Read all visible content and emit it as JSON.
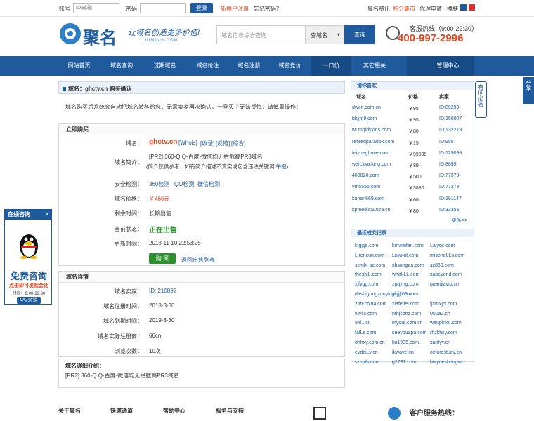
{
  "topbar": {
    "account_label": "账号",
    "account_placeholder": "ID/邮箱",
    "password_label": "密码",
    "login": "登录",
    "register": "新用户注册",
    "forgot": "忘记密码？",
    "news": "聚名资讯",
    "points": "积分集市",
    "agent": "代理申请",
    "skin": "换肤"
  },
  "header": {
    "logo": "聚名",
    "slogan": "让域名创造更多价值!",
    "slogan_sub": "JUMING.COM",
    "search_placeholder": "域名信息综合查询",
    "search_select": "查域名",
    "search_button": "查询",
    "phone_label": "客服热线（9:00-22:30）",
    "phone": "400-997-2996"
  },
  "nav": [
    "网站首页",
    "域名查询",
    "过期域名",
    "域名抢注",
    "域名注册",
    "域名竞价",
    "一口价",
    "其它相关",
    "管理中心"
  ],
  "crumb": "域名：ghctv.cn 购买确认",
  "note": "域名购买后系统会自动把域名转移给您，无需卖家再次确认，一旦买了无法反悔，请慎重操作！",
  "buy": {
    "title": "立即购买",
    "domain_label": "域名：",
    "domain": "ghctv.cn",
    "whois": "[Whois]",
    "indexed": "[收录]",
    "backlinks": "[反链]",
    "overall": "[综合]",
    "intro_label": "域名简介：",
    "intro": "[PR2] 360-Q Q-百度-微信均无拦截高PR3域名",
    "intro_note": "(简介仅供参考，如有简介描述不真实或包含违法关键词",
    "report": "举报",
    "intro_close": ")",
    "safety_label": "安全检测：",
    "check360": "360检测",
    "checkqq": "QQ检测",
    "checkwx": "微信检测",
    "price_label": "域名价格：",
    "price": "￥466元",
    "remaining_label": "剩余时间：",
    "remaining": "长期出售",
    "status_label": "当前状态：",
    "status": "正在出售",
    "update_label": "更新时间：",
    "update": "2018-11-10 22:53:25",
    "buy_button": "购 买",
    "back": "返回出售列表"
  },
  "detail": {
    "title": "域名详情",
    "seller_label": "域名卖家：",
    "seller": "ID: 210892",
    "reg_label": "域名注册时间：",
    "reg": "2018-3-30",
    "exp_label": "域名到期时间：",
    "exp": "2019-3-30",
    "registrar_label": "域名实际注册商：",
    "registrar": "66cn",
    "views_label": "浏览次数：",
    "views": "10次"
  },
  "intro_box": {
    "title": "域名详细介绍：",
    "text": "[PR2] 360-Q Q-百度-微信均无拦截高PR3域名"
  },
  "guess": {
    "title": "猜你喜欢",
    "col_domain": "域名",
    "col_price": "价格",
    "col_seller": "卖家",
    "more": "更多>>",
    "rows": [
      [
        "dwcn.com.cn",
        "￥95",
        "ID:80293"
      ],
      [
        "bkjjm9.com",
        "￥95",
        "ID:150007"
      ],
      [
        "wLmqidykids.com",
        "￥80",
        "ID:132273"
      ],
      [
        "retiredparadox.com",
        "￥15",
        "ID:985"
      ],
      [
        "feiyuegLove.com",
        "￥99999",
        "ID:129099"
      ],
      [
        "weiLipacking.com",
        "￥89",
        "ID:8899"
      ],
      [
        "488820.com",
        "￥500",
        "ID:77379"
      ],
      [
        "ym5555.com",
        "￥3880",
        "ID:77379"
      ],
      [
        "kunan669.com",
        "￥60",
        "ID:191147"
      ],
      [
        "kpmedicaLusa.cn",
        "￥80",
        "ID:33355"
      ]
    ]
  },
  "recent": {
    "title": "最近成交记录",
    "rows": [
      [
        "kfgjgs.com",
        "kmweifan.com",
        "Lajyqc.com"
      ],
      [
        "Lirencun.com",
        "Lnwxnt.com",
        "misoneLLs.com"
      ],
      [
        "scmhi-ac.com",
        "shsangao.com",
        "sz860.com"
      ],
      [
        "theshiL.com",
        "whakLL.com",
        "xabeyond.com"
      ],
      [
        "xjfygg.com",
        "zpqyhg.com",
        "guanjiavip.cn"
      ],
      [
        "dashigongzuoyidgkxjh.com",
        "xcjj168.com",
        ""
      ],
      [
        "zhb-china.com",
        "xiafeifei.com",
        "fjxmxyx.com"
      ],
      [
        "fuyijc.com",
        "nthjcbnz.com",
        "000a2.cn"
      ],
      [
        "54i1.cn",
        "myour.com.cn",
        "wanpinku.com"
      ],
      [
        "fafLs.com",
        "seeyouapa.com",
        "rhzkhsy.com"
      ],
      [
        "dhhxy.com.cn",
        "ka1905.com",
        "xahfyy.cn"
      ],
      [
        "evdaiLy.cn",
        "ikwave.cn",
        "oxfordstudy.cn"
      ],
      [
        "szsrds.com",
        "g2731.com",
        "huiyueshengwi"
      ]
    ]
  },
  "footer": [
    "关于聚名",
    "快速通道",
    "帮助中心",
    "服务与支持",
    "客户服务热线："
  ],
  "share": "分享",
  "must": "有问必答",
  "qq": {
    "title": "在线咨询",
    "close": "×",
    "free": "免费咨询",
    "click": "点击即可发起会话",
    "hours": "时间：9:00-22:30",
    "button": "QQ交谈"
  },
  "colors": {
    "brand": "#1f5b9c",
    "price": "#e8431c",
    "buy": "#2d8f2f"
  }
}
